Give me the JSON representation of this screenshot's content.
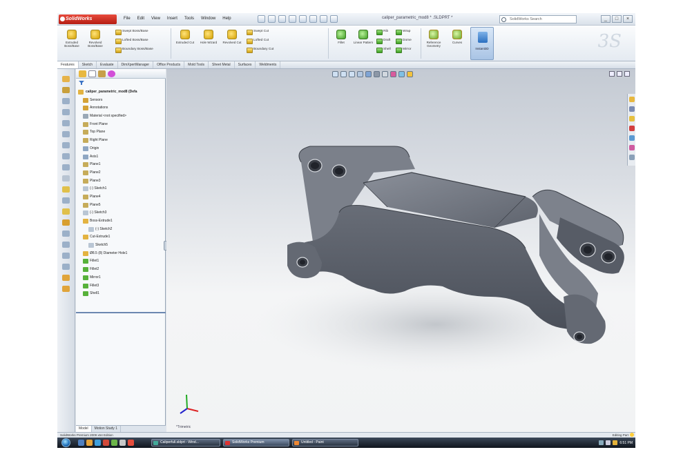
{
  "app": {
    "logo_text": "SolidWorks",
    "menus": [
      "File",
      "Edit",
      "View",
      "Insert",
      "Tools",
      "Window",
      "Help"
    ],
    "doc_title": "caliper_parametric_mod8 * .SLDPRT *",
    "search_placeholder": "SolidWorks Search",
    "window_controls": [
      "_",
      "□",
      "×"
    ]
  },
  "ribbon": {
    "big_buttons": [
      {
        "label": "Extruded Boss/Base",
        "icon": "extrude-boss-icon"
      },
      {
        "label": "Revolved Boss/Base",
        "icon": "revolve-boss-icon"
      },
      {
        "label": "Extruded Cut",
        "icon": "extrude-cut-icon"
      },
      {
        "label": "Hole Wizard",
        "icon": "hole-wizard-icon"
      },
      {
        "label": "Revolved Cut",
        "icon": "revolve-cut-icon"
      },
      {
        "label": "Fillet",
        "icon": "fillet-icon"
      },
      {
        "label": "Linear Pattern",
        "icon": "linear-pattern-icon"
      },
      {
        "label": "Reference Geometry",
        "icon": "reference-geometry-icon"
      },
      {
        "label": "Curves",
        "icon": "curves-icon"
      }
    ],
    "small_buttons": [
      "Swept Boss/Base",
      "Lofted Boss/Base",
      "Boundary Boss/Base",
      "Swept Cut",
      "Lofted Cut",
      "Boundary Cut",
      "Rib",
      "Draft",
      "Shell",
      "Wrap",
      "Dome",
      "Mirror"
    ],
    "instant3d_label": "Instant3D"
  },
  "command_tabs": [
    "Features",
    "Sketch",
    "Evaluate",
    "DimXpertManager",
    "Office Products",
    "Mold Tools",
    "Sheet Metal",
    "Surfaces",
    "Weldments"
  ],
  "feature_tree": {
    "root": "caliper_parametric_mod8 (Defa",
    "items": [
      "Sensors",
      "Annotations",
      "Material <not specified>",
      "Front Plane",
      "Top Plane",
      "Right Plane",
      "Origin",
      "Axis1",
      "Plane1",
      "Plane2",
      "Plane3",
      "(-) Sketch1",
      "Plane4",
      "Plane5",
      "(-) Sketch3",
      "Boss-Extrude1",
      "(-) Sketch2",
      "Cut-Extrude1",
      "Sketch5",
      "Ø8.5 (8) Diameter Hole1",
      "Fillet1",
      "Fillet2",
      "Mirror1",
      "Fillet3",
      "Shell1"
    ],
    "bottom_tabs": [
      "Model",
      "Motion Study 1"
    ]
  },
  "viewport": {
    "view_label": "*Trimetric"
  },
  "statusbar": {
    "left": "SolidWorks Premium 2009 x64 Edition",
    "right": "Editing Part"
  },
  "taskbar": {
    "tasks": [
      {
        "label": "Caliperfull.sldprt - Wind...",
        "color": "#4a9"
      },
      {
        "label": "SolidWorks Premium",
        "color": "#d33"
      },
      {
        "label": "Untitled - Paint",
        "color": "#e83"
      }
    ],
    "tray_text": "6:51 PM"
  },
  "colors": {
    "part_body": "#6c717b",
    "accent": "#1f6fb9",
    "brand_red": "#d32a1c"
  }
}
